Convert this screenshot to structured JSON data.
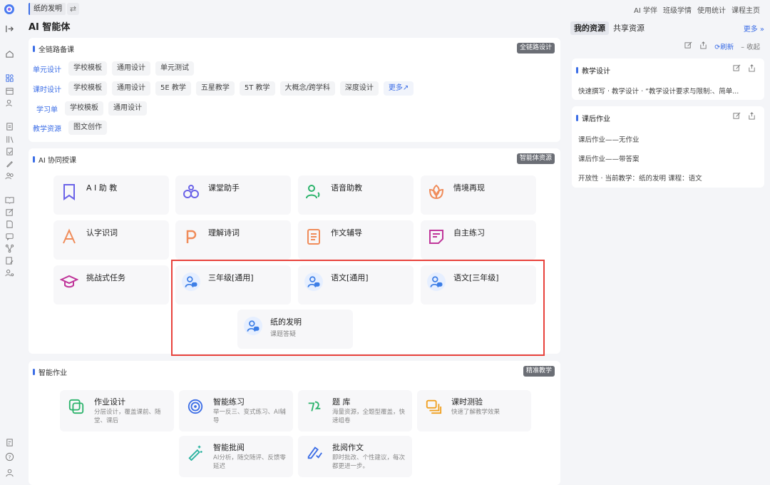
{
  "rail": {
    "logo": "app-logo-icon",
    "icons": [
      "expand-icon",
      "home-icon",
      "apps-icon",
      "calendar-icon",
      "users-icon",
      "document-icon",
      "books-icon",
      "file-check-icon",
      "pen-icon",
      "group-icon",
      "book-open-icon",
      "edit-icon",
      "file-icon",
      "chat-icon",
      "network-icon",
      "note-edit-icon",
      "user-settings-icon",
      "clipboard-icon",
      "help-icon",
      "profile-icon"
    ]
  },
  "topbar": {
    "doc_tag": "纸的发明",
    "links": [
      "AI 学伴",
      "班级学情",
      "使用统计",
      "课程主页"
    ]
  },
  "page_title": "AI 智能体",
  "full_chain": {
    "title": "全链路备课",
    "badge": "全链路设计",
    "rows": [
      {
        "label": "单元设计",
        "chips": [
          "学校模板",
          "通用设计",
          "单元测试"
        ]
      },
      {
        "label": "课时设计",
        "chips": [
          "学校模板",
          "通用设计",
          "5E 教学",
          "五星教学",
          "5T 教学",
          "大概念/跨学科",
          "深度设计"
        ],
        "more": "更多"
      },
      {
        "label": "学习单",
        "chips": [
          "学校模板",
          "通用设计"
        ]
      },
      {
        "label": "教学资源",
        "chips": [
          "图文创作"
        ]
      }
    ]
  },
  "ai_collab": {
    "title": "AI 协同授课",
    "badge": "智能体资源",
    "tiles": [
      {
        "title": "A I 助 教",
        "icon": "bookmark-icon",
        "color": "#6b63e8"
      },
      {
        "title": "课堂助手",
        "icon": "circles-icon",
        "color": "#6b63e8"
      },
      {
        "title": "语音助教",
        "icon": "voice-user-icon",
        "color": "#2bb36b"
      },
      {
        "title": "情境再现",
        "icon": "flower-icon",
        "color": "#f08c5a"
      },
      {
        "title": "认字识词",
        "icon": "letter-a-icon",
        "color": "#f08c5a"
      },
      {
        "title": "理解诗词",
        "icon": "letter-p-icon",
        "color": "#f08c5a"
      },
      {
        "title": "作文辅导",
        "icon": "document-lines-icon",
        "color": "#f08c5a"
      },
      {
        "title": "自主练习",
        "icon": "note-icon",
        "color": "#c0369a"
      },
      {
        "title": "挑战式任务",
        "icon": "graduation-cap-icon",
        "color": "#c0369a"
      },
      {
        "title": "三年级[通用]",
        "icon": "agent-avatar-icon",
        "color": "#3b7de6"
      },
      {
        "title": "语文[通用]",
        "icon": "agent-avatar-icon",
        "color": "#3b7de6"
      },
      {
        "title": "语文[三年级]",
        "icon": "agent-avatar-icon",
        "color": "#3b7de6"
      },
      {
        "title": "纸的发明",
        "subtitle": "课题答疑",
        "icon": "agent-avatar-icon",
        "color": "#3b7de6"
      }
    ]
  },
  "homework": {
    "title": "智能作业",
    "badge": "精准教学",
    "tiles": [
      {
        "title": "作业设计",
        "desc": "分层设计，覆盖课前、随堂、课后",
        "icon": "layers-icon",
        "color": "#2bb36b"
      },
      {
        "title": "智能练习",
        "desc": "举一反三、变式练习、AI辅导",
        "icon": "target-icon",
        "color": "#3b6de6"
      },
      {
        "title": "题 库",
        "desc": "海量资源，全题型覆盖，快速组卷",
        "icon": "question-bank-icon",
        "color": "#2bb36b"
      },
      {
        "title": "课时测验",
        "desc": "快速了解教学效果",
        "icon": "stack-icon",
        "color": "#f0a020"
      },
      {
        "title": "智能批阅",
        "desc": "AI分析，随交随评、反馈零延迟",
        "icon": "magic-pen-icon",
        "color": "#2bb3a0"
      },
      {
        "title": "批阅作文",
        "desc": "即时批改、个性建议，每次都更进一步。",
        "icon": "grading-icon",
        "color": "#3b6de6"
      }
    ]
  },
  "right_panel": {
    "tab_active": "我的资源",
    "tab_other": "共享资源",
    "more": "更多 »",
    "tools": {
      "refresh": "刷新",
      "collapse": "收起"
    },
    "cards": [
      {
        "title": "教学设计",
        "lines": [
          "快速撰写 · 教学设计 · “教学设计要求与限制:、简单..."
        ]
      },
      {
        "title": "课后作业",
        "lines": [
          "课后作业——无作业",
          "课后作业——带答案",
          "开放性 · 当前教学：纸的发明 课程：语文"
        ]
      }
    ]
  }
}
